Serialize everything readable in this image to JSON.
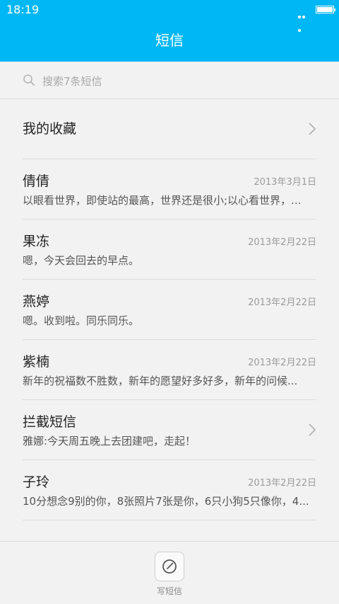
{
  "status_bar": {
    "time": "18:19"
  },
  "header": {
    "title": "短信"
  },
  "search": {
    "placeholder": "搜索7条短信"
  },
  "favorites": {
    "label": "我的收藏"
  },
  "conversations": [
    {
      "name": "倩倩",
      "date": "2013年3月1日",
      "preview": "以眼看世界，即使站的最高，世界还是很小;以心看世界，..."
    },
    {
      "name": "果冻",
      "date": "2013年2月22日",
      "preview": "嗯，今天会回去的早点。"
    },
    {
      "name": "燕婷",
      "date": "2013年2月22日",
      "preview": "嗯。收到啦。同乐同乐。"
    },
    {
      "name": "紫楠",
      "date": "2013年2月22日",
      "preview": "新年的祝福数不胜数，新年的愿望好多好多，新年的问候..."
    },
    {
      "name": "拦截短信",
      "date": "",
      "preview": "雅娜:今天周五晚上去团建吧，走起！"
    },
    {
      "name": "子玲",
      "date": "2013年2月22日",
      "preview": "10分想念9别的你，8张照片7张是你，6只小狗5只像你，4..."
    }
  ],
  "compose": {
    "label": "写短信",
    "icon": "compose-icon"
  },
  "colors": {
    "accent": "#00b7f5",
    "background": "#f2f2f2"
  }
}
